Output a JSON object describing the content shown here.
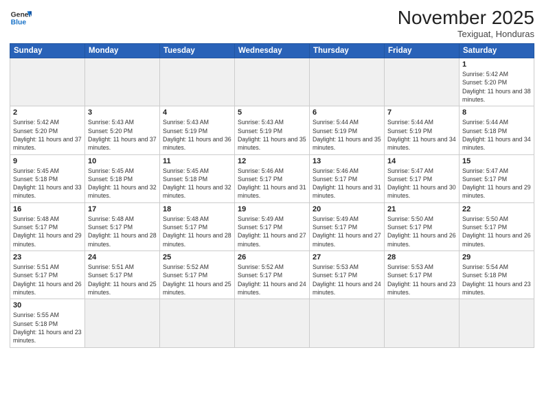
{
  "logo": {
    "text_general": "General",
    "text_blue": "Blue"
  },
  "header": {
    "month_year": "November 2025",
    "location": "Texiguat, Honduras"
  },
  "days_of_week": [
    "Sunday",
    "Monday",
    "Tuesday",
    "Wednesday",
    "Thursday",
    "Friday",
    "Saturday"
  ],
  "weeks": [
    [
      {
        "day": "",
        "info": ""
      },
      {
        "day": "",
        "info": ""
      },
      {
        "day": "",
        "info": ""
      },
      {
        "day": "",
        "info": ""
      },
      {
        "day": "",
        "info": ""
      },
      {
        "day": "",
        "info": ""
      },
      {
        "day": "1",
        "info": "Sunrise: 5:42 AM\nSunset: 5:20 PM\nDaylight: 11 hours and 38 minutes."
      }
    ],
    [
      {
        "day": "2",
        "info": "Sunrise: 5:42 AM\nSunset: 5:20 PM\nDaylight: 11 hours and 37 minutes."
      },
      {
        "day": "3",
        "info": "Sunrise: 5:43 AM\nSunset: 5:20 PM\nDaylight: 11 hours and 37 minutes."
      },
      {
        "day": "4",
        "info": "Sunrise: 5:43 AM\nSunset: 5:19 PM\nDaylight: 11 hours and 36 minutes."
      },
      {
        "day": "5",
        "info": "Sunrise: 5:43 AM\nSunset: 5:19 PM\nDaylight: 11 hours and 35 minutes."
      },
      {
        "day": "6",
        "info": "Sunrise: 5:44 AM\nSunset: 5:19 PM\nDaylight: 11 hours and 35 minutes."
      },
      {
        "day": "7",
        "info": "Sunrise: 5:44 AM\nSunset: 5:19 PM\nDaylight: 11 hours and 34 minutes."
      },
      {
        "day": "8",
        "info": "Sunrise: 5:44 AM\nSunset: 5:18 PM\nDaylight: 11 hours and 34 minutes."
      }
    ],
    [
      {
        "day": "9",
        "info": "Sunrise: 5:45 AM\nSunset: 5:18 PM\nDaylight: 11 hours and 33 minutes."
      },
      {
        "day": "10",
        "info": "Sunrise: 5:45 AM\nSunset: 5:18 PM\nDaylight: 11 hours and 32 minutes."
      },
      {
        "day": "11",
        "info": "Sunrise: 5:45 AM\nSunset: 5:18 PM\nDaylight: 11 hours and 32 minutes."
      },
      {
        "day": "12",
        "info": "Sunrise: 5:46 AM\nSunset: 5:17 PM\nDaylight: 11 hours and 31 minutes."
      },
      {
        "day": "13",
        "info": "Sunrise: 5:46 AM\nSunset: 5:17 PM\nDaylight: 11 hours and 31 minutes."
      },
      {
        "day": "14",
        "info": "Sunrise: 5:47 AM\nSunset: 5:17 PM\nDaylight: 11 hours and 30 minutes."
      },
      {
        "day": "15",
        "info": "Sunrise: 5:47 AM\nSunset: 5:17 PM\nDaylight: 11 hours and 29 minutes."
      }
    ],
    [
      {
        "day": "16",
        "info": "Sunrise: 5:48 AM\nSunset: 5:17 PM\nDaylight: 11 hours and 29 minutes."
      },
      {
        "day": "17",
        "info": "Sunrise: 5:48 AM\nSunset: 5:17 PM\nDaylight: 11 hours and 28 minutes."
      },
      {
        "day": "18",
        "info": "Sunrise: 5:48 AM\nSunset: 5:17 PM\nDaylight: 11 hours and 28 minutes."
      },
      {
        "day": "19",
        "info": "Sunrise: 5:49 AM\nSunset: 5:17 PM\nDaylight: 11 hours and 27 minutes."
      },
      {
        "day": "20",
        "info": "Sunrise: 5:49 AM\nSunset: 5:17 PM\nDaylight: 11 hours and 27 minutes."
      },
      {
        "day": "21",
        "info": "Sunrise: 5:50 AM\nSunset: 5:17 PM\nDaylight: 11 hours and 26 minutes."
      },
      {
        "day": "22",
        "info": "Sunrise: 5:50 AM\nSunset: 5:17 PM\nDaylight: 11 hours and 26 minutes."
      }
    ],
    [
      {
        "day": "23",
        "info": "Sunrise: 5:51 AM\nSunset: 5:17 PM\nDaylight: 11 hours and 26 minutes."
      },
      {
        "day": "24",
        "info": "Sunrise: 5:51 AM\nSunset: 5:17 PM\nDaylight: 11 hours and 25 minutes."
      },
      {
        "day": "25",
        "info": "Sunrise: 5:52 AM\nSunset: 5:17 PM\nDaylight: 11 hours and 25 minutes."
      },
      {
        "day": "26",
        "info": "Sunrise: 5:52 AM\nSunset: 5:17 PM\nDaylight: 11 hours and 24 minutes."
      },
      {
        "day": "27",
        "info": "Sunrise: 5:53 AM\nSunset: 5:17 PM\nDaylight: 11 hours and 24 minutes."
      },
      {
        "day": "28",
        "info": "Sunrise: 5:53 AM\nSunset: 5:17 PM\nDaylight: 11 hours and 23 minutes."
      },
      {
        "day": "29",
        "info": "Sunrise: 5:54 AM\nSunset: 5:18 PM\nDaylight: 11 hours and 23 minutes."
      }
    ],
    [
      {
        "day": "30",
        "info": "Sunrise: 5:55 AM\nSunset: 5:18 PM\nDaylight: 11 hours and 23 minutes."
      },
      {
        "day": "",
        "info": ""
      },
      {
        "day": "",
        "info": ""
      },
      {
        "day": "",
        "info": ""
      },
      {
        "day": "",
        "info": ""
      },
      {
        "day": "",
        "info": ""
      },
      {
        "day": "",
        "info": ""
      }
    ]
  ]
}
